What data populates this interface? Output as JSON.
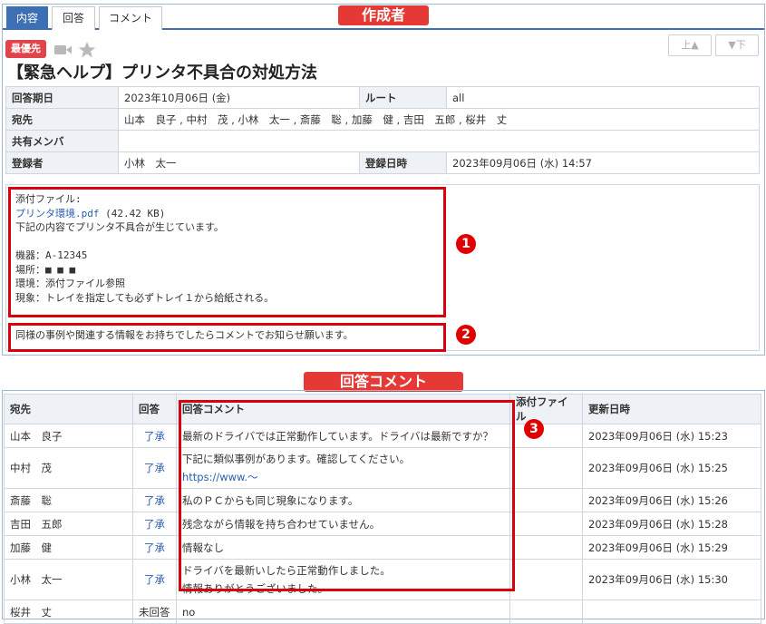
{
  "annotations": {
    "creator_banner": "作成者",
    "reply_banner": "回答コメント",
    "markers": [
      "1",
      "2",
      "3"
    ]
  },
  "tabs": [
    {
      "label": "内容",
      "active": true
    },
    {
      "label": "回答",
      "active": false
    },
    {
      "label": "コメント",
      "active": false
    }
  ],
  "header": {
    "priority_badge": "最優先",
    "prev_button": "上▲",
    "next_button": "▼下",
    "title": "【緊急ヘルプ】プリンタ不具合の対処方法"
  },
  "info": {
    "due_label": "回答期日",
    "due_value": "2023年10月06日 (金)",
    "route_label": "ルート",
    "route_value": "all",
    "to_label": "宛先",
    "to_value": "山本　良子 , 中村　茂 , 小林　太一 , 斎藤　聡 , 加藤　健 , 吉田　五郎 , 桜井　丈",
    "shared_label": "共有メンバ",
    "shared_value": "",
    "registrant_label": "登録者",
    "registrant_value": "小林　太一",
    "registered_label": "登録日時",
    "registered_value": "2023年09月06日 (水) 14:57"
  },
  "body": {
    "attachment_label": "添付ファイル:",
    "attachment_name": "プリンタ環境.pdf",
    "attachment_size": " (42.42 KB)",
    "line1": "下記の内容でプリンタ不具合が生じています。",
    "machine": "機器：A-12345",
    "place": "場所：■ ■ ■",
    "env": "環境：添付ファイル参照",
    "symptom": "現象：トレイを指定しても必ずトレイ１から給紙される。",
    "request": "同様の事例や関連する情報をお持ちでしたらコメントでお知らせ願います。"
  },
  "comments": {
    "headers": {
      "to": "宛先",
      "reply": "回答",
      "comment": "回答コメント",
      "attachment": "添付ファイル",
      "updated": "更新日時"
    },
    "rows": [
      {
        "name": "山本　良子",
        "reply": "了承",
        "comment": "最新のドライバでは正常動作しています。ドライバは最新ですか？",
        "comment2": "",
        "attachment": "",
        "updated": "2023年09月06日 (水) 15:23"
      },
      {
        "name": "中村　茂",
        "reply": "了承",
        "comment": "下記に類似事例があります。確認してください。",
        "comment2": "https://www.～",
        "attachment": "",
        "updated": "2023年09月06日 (水) 15:25"
      },
      {
        "name": "斎藤　聡",
        "reply": "了承",
        "comment": "私のＰＣからも同じ現象になります。",
        "comment2": "",
        "attachment": "",
        "updated": "2023年09月06日 (水) 15:26"
      },
      {
        "name": "吉田　五郎",
        "reply": "了承",
        "comment": "残念ながら情報を持ち合わせていません。",
        "comment2": "",
        "attachment": "",
        "updated": "2023年09月06日 (水) 15:28"
      },
      {
        "name": "加藤　健",
        "reply": "了承",
        "comment": "情報なし",
        "comment2": "",
        "attachment": "",
        "updated": "2023年09月06日 (水) 15:29"
      },
      {
        "name": "小林　太一",
        "reply": "了承",
        "comment": "ドライバを最新いしたら正常動作しました。",
        "comment2": "情報ありがとうございました。",
        "attachment": "",
        "updated": "2023年09月06日 (水) 15:30"
      },
      {
        "name": "桜井　丈",
        "reply": "未回答",
        "comment": "no",
        "comment2": "",
        "attachment": "",
        "updated": ""
      }
    ]
  },
  "icons": {
    "video": "video-camera-icon",
    "star": "star-icon"
  },
  "colors": {
    "tab_active": "#3d6fb5",
    "annotation_red": "#e53935",
    "link_blue": "#2a5db0",
    "badge_red": "#e0454b"
  }
}
